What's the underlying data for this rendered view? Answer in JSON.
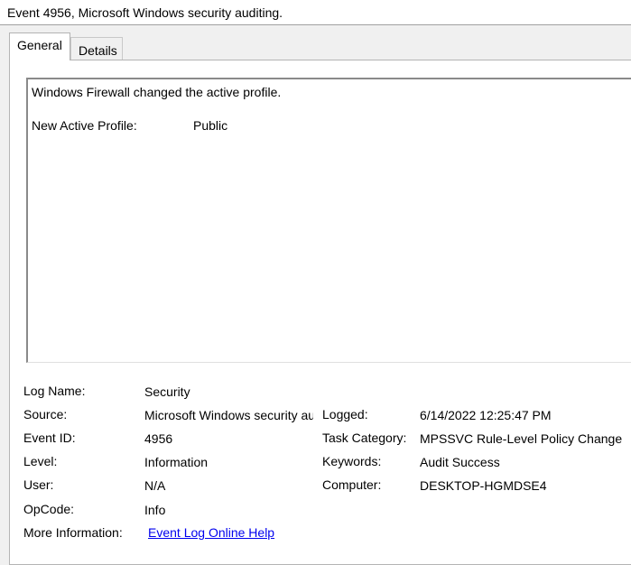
{
  "window": {
    "title": "Event 4956, Microsoft Windows security auditing."
  },
  "tabs": [
    {
      "label": "General",
      "active": true
    },
    {
      "label": "Details",
      "active": false
    }
  ],
  "description": {
    "line1": "Windows Firewall changed the active profile.",
    "profile_label": "New Active Profile:",
    "profile_value": "Public"
  },
  "details": {
    "log_name_label": "Log Name:",
    "log_name": "Security",
    "source_label": "Source:",
    "source": "Microsoft Windows security auditing.",
    "logged_label": "Logged:",
    "logged": "6/14/2022 12:25:47 PM",
    "event_id_label": "Event ID:",
    "event_id": "4956",
    "task_category_label": "Task Category:",
    "task_category": "MPSSVC Rule-Level Policy Change",
    "level_label": "Level:",
    "level": "Information",
    "keywords_label": "Keywords:",
    "keywords": "Audit Success",
    "user_label": "User:",
    "user": "N/A",
    "computer_label": "Computer:",
    "computer": "DESKTOP-HGMDSE4",
    "opcode_label": "OpCode:",
    "opcode": "Info",
    "more_info_label": "More Information:",
    "more_info_link": "Event Log Online Help"
  },
  "colors": {
    "link": "#0000ee",
    "panel_bg": "#ffffff",
    "window_bg": "#f0f0f0"
  }
}
